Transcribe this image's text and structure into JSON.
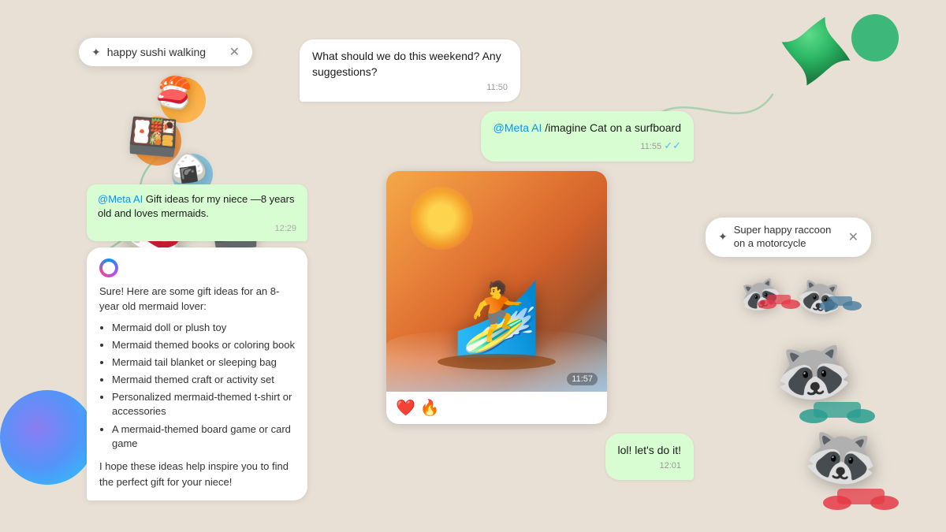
{
  "search_bar": {
    "icon": "✦",
    "text": "happy sushi walking",
    "close": "✕"
  },
  "raccoon_search_bar": {
    "icon": "✦",
    "text": "Super happy raccoon on a motorcycle",
    "close": "✕"
  },
  "chat": {
    "incoming_1": {
      "text": "What should we do this weekend? Any suggestions?",
      "time": "11:50"
    },
    "outgoing_1": {
      "meta_mention": "@Meta AI",
      "command": " /imagine Cat on a surfboard",
      "time": "11:55"
    },
    "image_time": "11:57",
    "reactions": [
      "❤️",
      "🔥"
    ],
    "outgoing_2": {
      "text": "lol! let's do it!",
      "time": "12:01"
    }
  },
  "left_chat": {
    "gift_outgoing": {
      "meta_mention": "@Meta AI",
      "text": " Gift ideas for my niece —8 years old and loves mermaids.",
      "time": "12:29"
    },
    "ai_response": {
      "intro": "Sure! Here are some gift ideas for an 8-year old mermaid lover:",
      "items": [
        "Mermaid doll or plush toy",
        "Mermaid themed books or coloring book",
        "Mermaid tail blanket or sleeping bag",
        "Mermaid themed craft or activity set",
        "Personalized mermaid-themed t-shirt or accessories",
        "A mermaid-themed board game or card game"
      ],
      "outro": "I hope these ideas help inspire you to find the perfect gift for your niece!"
    }
  },
  "colors": {
    "bg": "#e8e0d5",
    "bubble_outgoing": "#d9fdd3",
    "meta_blue": "#0095f6",
    "green_accent": "#3db87a"
  }
}
